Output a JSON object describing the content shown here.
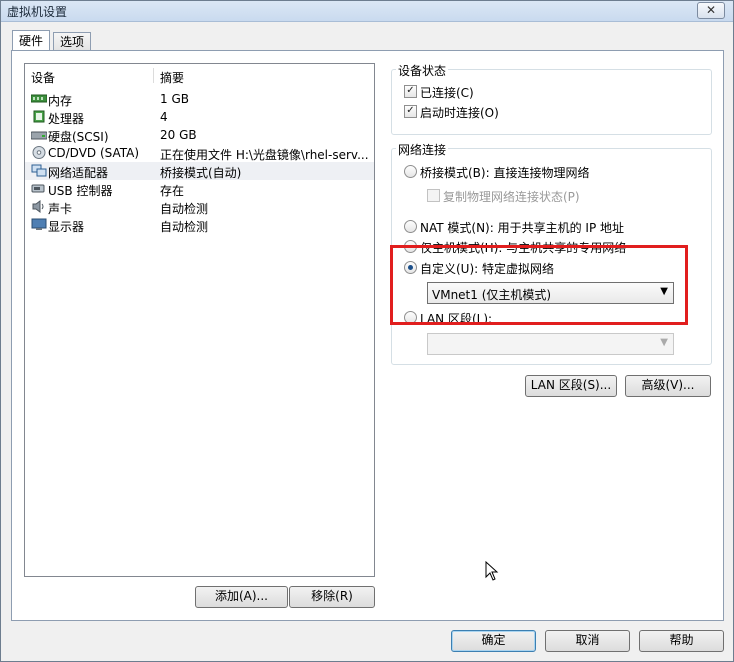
{
  "window": {
    "title": "虚拟机设置",
    "close_glyph": "✕"
  },
  "tabs": [
    {
      "label": "硬件",
      "active": true
    },
    {
      "label": "选项",
      "active": false
    }
  ],
  "device_list": {
    "headers": {
      "device": "设备",
      "summary": "摘要"
    },
    "rows": [
      {
        "icon": "memory-icon",
        "name": "内存",
        "summary": "1 GB"
      },
      {
        "icon": "processor-icon",
        "name": "处理器",
        "summary": "4"
      },
      {
        "icon": "hard-disk-icon",
        "name": "硬盘(SCSI)",
        "summary": "20 GB"
      },
      {
        "icon": "cd-dvd-icon",
        "name": "CD/DVD (SATA)",
        "summary": "正在使用文件 H:\\光盘镜像\\rhel-serv..."
      },
      {
        "icon": "network-adapter-icon",
        "name": "网络适配器",
        "summary": "桥接模式(自动)",
        "selected": true
      },
      {
        "icon": "usb-icon",
        "name": "USB 控制器",
        "summary": "存在"
      },
      {
        "icon": "sound-card-icon",
        "name": "声卡",
        "summary": "自动检测"
      },
      {
        "icon": "display-icon",
        "name": "显示器",
        "summary": "自动检测"
      }
    ],
    "add_button": "添加(A)...",
    "remove_button": "移除(R)"
  },
  "device_status": {
    "label": "设备状态",
    "connected": {
      "label": "已连接(C)",
      "checked": true
    },
    "connect_on_start": {
      "label": "启动时连接(O)",
      "checked": true
    }
  },
  "network": {
    "label": "网络连接",
    "bridged": {
      "label": "桥接模式(B): 直接连接物理网络",
      "selected": false
    },
    "replicate": {
      "label": "复制物理网络连接状态(P)",
      "checked": false,
      "disabled": true
    },
    "nat": {
      "label": "NAT 模式(N): 用于共享主机的 IP 地址",
      "selected": false
    },
    "host_only": {
      "label": "仅主机模式(H): 与主机共享的专用网络",
      "selected": false
    },
    "custom": {
      "label": "自定义(U): 特定虚拟网络",
      "selected": true
    },
    "custom_select": "VMnet1 (仅主机模式)",
    "lan_segment": {
      "label": "LAN 区段(L):",
      "selected": false
    },
    "lan_select": "",
    "lan_segments_button": "LAN 区段(S)...",
    "advanced_button": "高级(V)..."
  },
  "footer": {
    "ok": "确定",
    "cancel": "取消",
    "help": "帮助"
  },
  "colors": {
    "highlight": "#e11e1e",
    "selection": "#1b4f8a"
  }
}
